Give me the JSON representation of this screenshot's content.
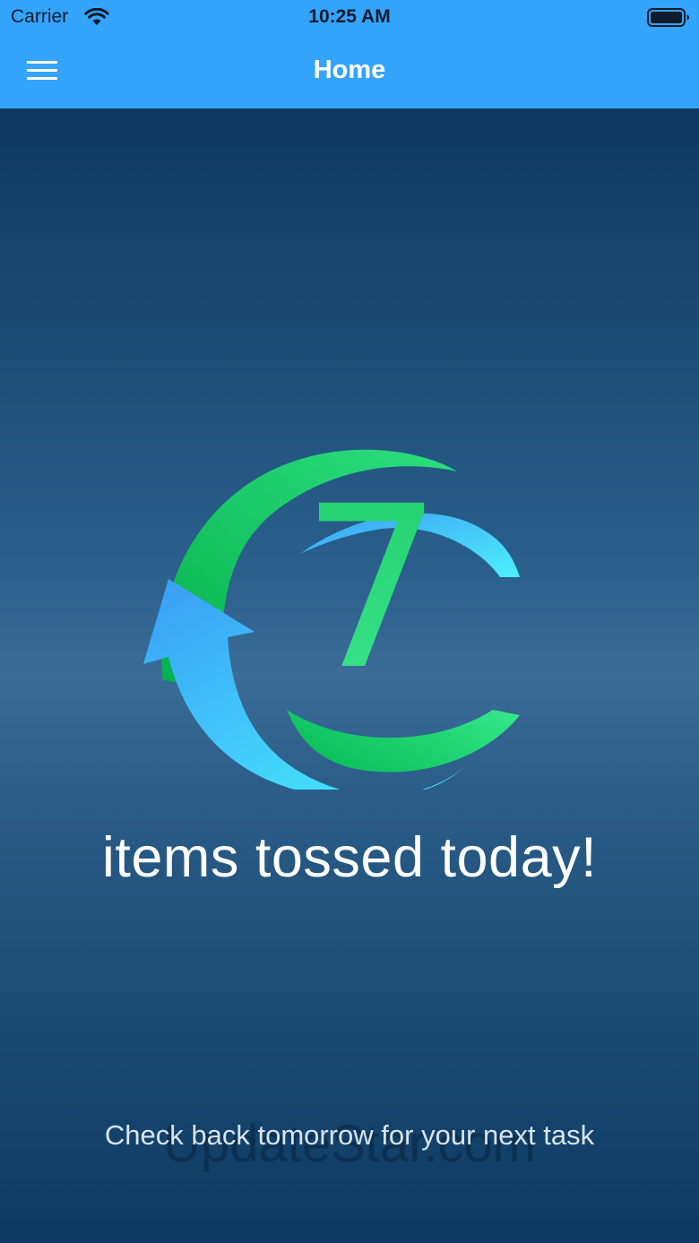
{
  "status_bar": {
    "carrier": "Carrier",
    "time": "10:25 AM"
  },
  "nav": {
    "title": "Home"
  },
  "main": {
    "count": "7",
    "tossed_label": "items tossed today!",
    "next_task_label": "Check back tomorrow for your next task"
  },
  "watermark": "UpdateStar.com",
  "colors": {
    "header_bg": "#34a4fc",
    "background_top": "#0c3861",
    "background_mid": "#3a6c97",
    "accent_green": "#20d27a",
    "accent_blue": "#3ba8f5",
    "accent_cyan": "#45e6fb"
  },
  "icons": {
    "menu": "hamburger-menu-icon",
    "wifi": "wifi-icon",
    "battery": "battery-icon",
    "logo": "recycle-arrows-logo"
  }
}
